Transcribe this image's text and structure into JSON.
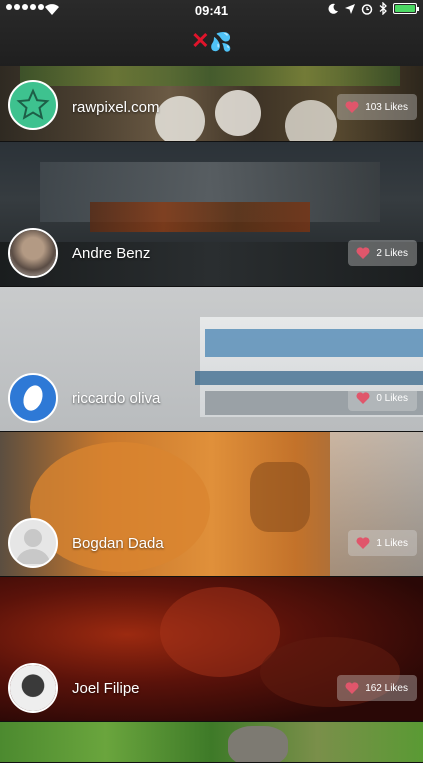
{
  "status_bar": {
    "time": "09:41"
  },
  "app": {
    "logo_mark": "✕",
    "logo_drops": "💦"
  },
  "feed": [
    {
      "name": "rawpixel.com",
      "likes": "103 Likes",
      "avatar_icon": "star-icon"
    },
    {
      "name": "Andre Benz",
      "likes": "2 Likes",
      "avatar_icon": "photo-avatar"
    },
    {
      "name": "riccardo oliva",
      "likes": "0 Likes",
      "avatar_icon": "oval-icon"
    },
    {
      "name": "Bogdan Dada",
      "likes": "1 Likes",
      "avatar_icon": "default-person-icon"
    },
    {
      "name": "Joel Filipe",
      "likes": "162 Likes",
      "avatar_icon": "photo-avatar"
    }
  ],
  "colors": {
    "accent_like": "#e0566b",
    "battery": "#4cd964",
    "logo_x": "#e0142b"
  }
}
